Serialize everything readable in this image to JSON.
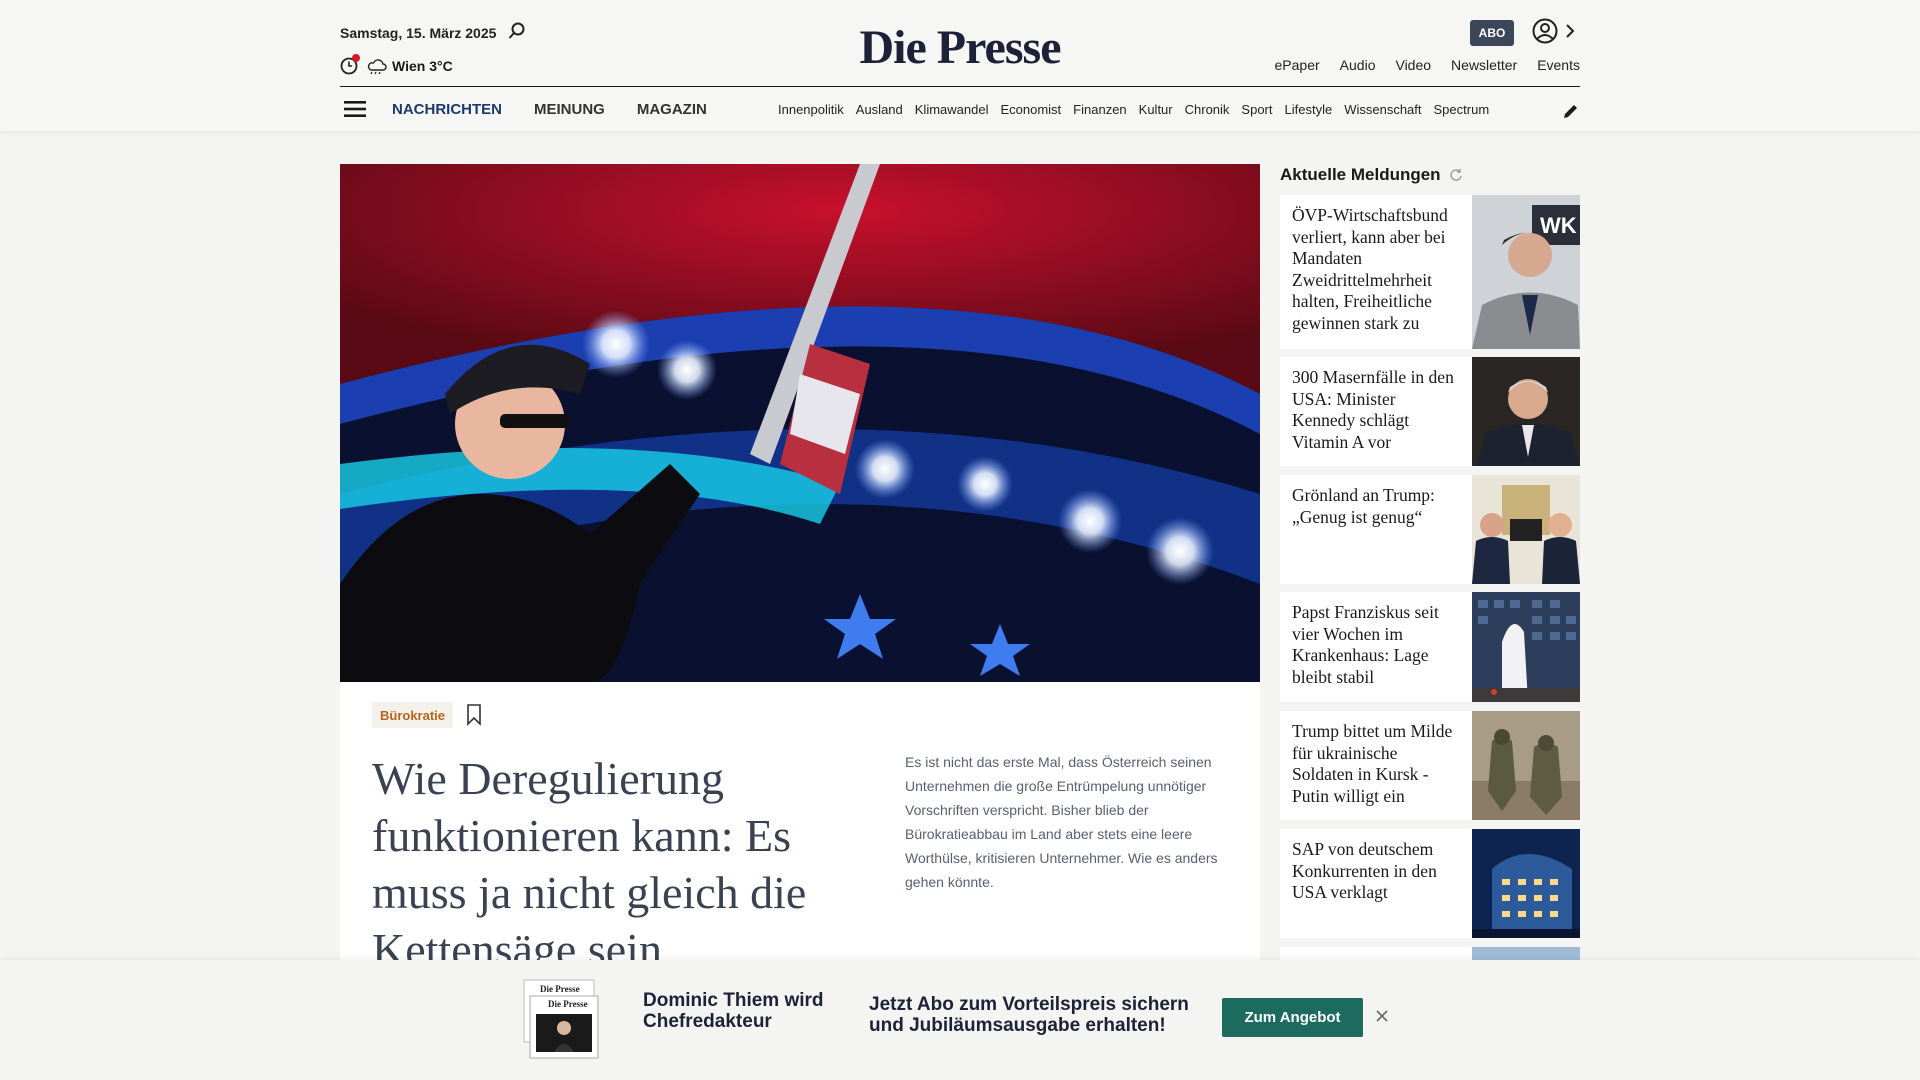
{
  "header": {
    "date": "Samstag, 15. März 2025",
    "weather": "Wien 3°C",
    "logo": "Die Presse",
    "abo_label": "ABO",
    "top_links": [
      "ePaper",
      "Audio",
      "Video",
      "Newsletter",
      "Events"
    ],
    "main_nav": [
      "NACHRICHTEN",
      "MEINUNG",
      "MAGAZIN"
    ],
    "sub_nav": [
      "Innenpolitik",
      "Ausland",
      "Klimawandel",
      "Economist",
      "Finanzen",
      "Kultur",
      "Chronik",
      "Sport",
      "Lifestyle",
      "Wissenschaft",
      "Spectrum"
    ],
    "icons": [
      "search-icon",
      "clock-icon",
      "cloud-icon",
      "user-icon",
      "chevron-right-icon",
      "menu-icon",
      "pen-icon"
    ]
  },
  "hero": {
    "tag": "Bürokratie",
    "headline": "Wie Deregulierung funktionieren kann: Es muss ja nicht gleich die Kettensäge sein",
    "teaser": "Es ist nicht das erste Mal, dass Österreich seinen Unternehmen die große Entrümpelung unnötiger Vorschriften verspricht. Bisher blieb der Bürokratieabbau im Land aber stets eine leere Worthülse, kritisieren Unternehmer. Wie es anders gehen könnte."
  },
  "sidebar": {
    "title": "Aktuelle Meldungen",
    "items": [
      {
        "text": "ÖVP-Wirtschaftsbund verliert, kann aber bei Mandaten Zweidrittelmehrheit halten, Freiheitliche gewinnen stark zu"
      },
      {
        "text": "300 Masernfälle in den USA: Minister Kennedy schlägt Vitamin A vor"
      },
      {
        "text": "Grönland an Trump: „Genug ist genug“"
      },
      {
        "text": "Papst Franziskus seit vier Wochen im Krankenhaus: Lage bleibt stabil"
      },
      {
        "text": "Trump bittet um Milde für ukrainische Soldaten in Kursk - Putin willigt ein"
      },
      {
        "text": "SAP von deutschem Konkurrenten in den USA verklagt"
      }
    ]
  },
  "promo": {
    "name": "Dominic Thiem wird Chefredakteur",
    "text": "Jetzt Abo zum Vorteilspreis sichern und Jubiläumsausgabe erhalten!",
    "button": "Zum Angebot",
    "newspaper_mini_title": "Die Presse"
  },
  "colors": {
    "brand_navy": "#1d2238",
    "accent_red": "#d71a21",
    "nav_blue": "#1d3a6e",
    "tag_orange": "#b5661e",
    "button_green": "#1d6b5e"
  }
}
